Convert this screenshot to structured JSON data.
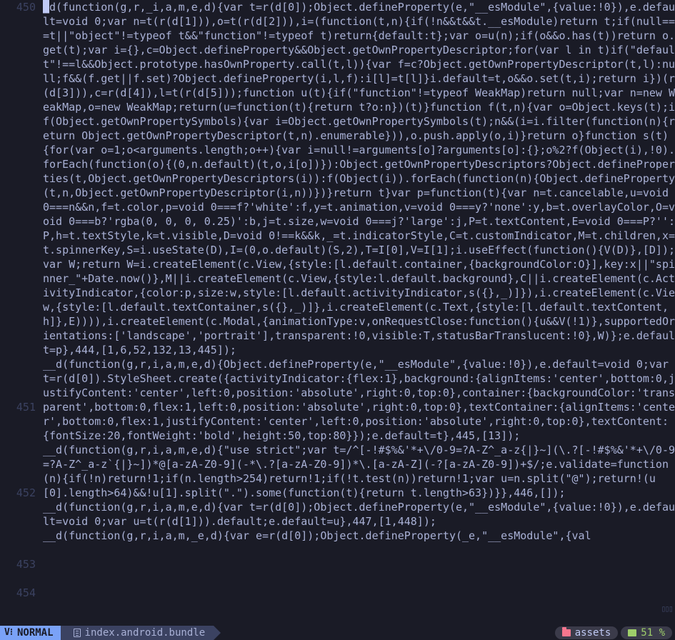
{
  "gutter": {
    "lines": [
      "450",
      "",
      "",
      "",
      "",
      "",
      "",
      "",
      "",
      "",
      "",
      "",
      "",
      "",
      "",
      "",
      "",
      "",
      "",
      "",
      "",
      "",
      "",
      "",
      "",
      "",
      "",
      "",
      "451",
      "",
      "",
      "",
      "",
      "",
      "452",
      "",
      "",
      "",
      "",
      "453",
      "",
      "454"
    ]
  },
  "code": {
    "segments": [
      {
        "ln": 450,
        "cursor": true,
        "text": "_d(function(g,r,_i,a,m,e,d){var t=r(d[0]);Object.defineProperty(e,\"__esModule\",{value:!0}),e.default=void 0;var n=t(r(d[1])),o=t(r(d[2])),i=(function(t,n){if(!n&&t&&t.__esModule)return t;if(null===t||\"object\"!=typeof t&&\"function\"!=typeof t)return{default:t};var o=u(n);if(o&&o.has(t))return o.get(t);var i={},c=Object.defineProperty&&Object.getOwnPropertyDescriptor;for(var l in t)if(\"default\"!==l&&Object.prototype.hasOwnProperty.call(t,l)){var f=c?Object.getOwnPropertyDescriptor(t,l):null;f&&(f.get||f.set)?Object.defineProperty(i,l,f):i[l]=t[l]}i.default=t,o&&o.set(t,i);return i})(r(d[3])),c=r(d[4]),l=t(r(d[5]));function u(t){if(\"function\"!=typeof WeakMap)return null;var n=new WeakMap,o=new WeakMap;return(u=function(t){return t?o:n})(t)}function f(t,n){var o=Object.keys(t);if(Object.getOwnPropertySymbols){var i=Object.getOwnPropertySymbols(t);n&&(i=i.filter(function(n){return Object.getOwnPropertyDescriptor(t,n).enumerable})),o.push.apply(o,i)}return o}function s(t){for(var o=1;o<arguments.length;o++){var i=null!=arguments[o]?arguments[o]:{};o%2?f(Object(i),!0).forEach(function(o){(0,n.default)(t,o,i[o])}):Object.getOwnPropertyDescriptors?Object.defineProperties(t,Object.getOwnPropertyDescriptors(i)):f(Object(i)).forEach(function(n){Object.defineProperty(t,n,Object.getOwnPropertyDescriptor(i,n))})}return t}var p=function(t){var n=t.cancelable,u=void 0===n&&n,f=t.color,p=void 0===f?'white':f,y=t.animation,v=void 0===y?'none':y,b=t.overlayColor,O=void 0===b?'rgba(0, 0, 0, 0.25)':b,j=t.size,w=void 0===j?'large':j,P=t.textContent,E=void 0===P?'':P,h=t.textStyle,k=t.visible,D=void 0!==k&&k,_=t.indicatorStyle,C=t.customIndicator,M=t.children,x=t.spinnerKey,S=i.useState(D),I=(0,o.default)(S,2),T=I[0],V=I[1];i.useEffect(function(){V(D)},[D]);var W;return W=i.createElement(c.View,{style:[l.default.container,{backgroundColor:O}],key:x||\"spinner_\"+Date.now()},M||i.createElement(c.View,{style:l.default.background},C||i.createElement(c.ActivityIndicator,{color:p,size:w,style:[l.default.activityIndicator,s({},_)]}),i.createElement(c.View,{style:[l.default.textContainer,s({},_)]},i.createElement(c.Text,{style:[l.default.textContent,h]},E)))),i.createElement(c.Modal,{animationType:v,onRequestClose:function(){u&&V(!1)},supportedOrientations:['landscape','portrait'],transparent:!0,visible:T,statusBarTranslucent:!0},W)};e.default=p},444,[1,6,52,132,13,445]);"
      },
      {
        "ln": 451,
        "text": "__d(function(g,r,i,a,m,e,d){Object.defineProperty(e,\"__esModule\",{value:!0}),e.default=void 0;var t=r(d[0]).StyleSheet.create({activityIndicator:{flex:1},background:{alignItems:'center',bottom:0,justifyContent:'center',left:0,position:'absolute',right:0,top:0},container:{backgroundColor:'transparent',bottom:0,flex:1,left:0,position:'absolute',right:0,top:0},textContainer:{alignItems:'center',bottom:0,flex:1,justifyContent:'center',left:0,position:'absolute',right:0,top:0},textContent:{fontSize:20,fontWeight:'bold',height:50,top:80}});e.default=t},445,[13]);"
      },
      {
        "ln": 452,
        "text": "__d(function(g,r,i,a,m,e,d){\"use strict\";var t=/^[-!#$%&'*+\\/0-9=?A-Z^_a-z{|}~](\\.?[-!#$%&'*+\\/0-9=?A-Z^_a-z`{|}~])*@[a-zA-Z0-9](-*\\.?[a-zA-Z0-9])*\\.[a-zA-Z](-?[a-zA-Z0-9])+$/;e.validate=function(n){if(!n)return!1;if(n.length>254)return!1;if(!t.test(n))return!1;var u=n.split(\"@\");return!(u[0].length>64)&&!u[1].split(\".\").some(function(t){return t.length>63})}},446,[]);"
      },
      {
        "ln": 453,
        "text": "__d(function(g,r,i,a,m,e,d){var t=r(d[0]);Object.defineProperty(e,\"__esModule\",{value:!0}),e.default=void 0;var u=t(r(d[1])).default;e.default=u},447,[1,448]);"
      },
      {
        "ln": 454,
        "text": "__d(function(g,r,i,a,m,_e,d){var e=r(d[0]);Object.defineProperty(_e,\"__esModule\",{val"
      }
    ]
  },
  "status": {
    "mode": "NORMAL",
    "filename": "index.android.bundle",
    "folder": "assets",
    "percent": "51 %"
  },
  "scroll_indicator": "▯▯▯"
}
